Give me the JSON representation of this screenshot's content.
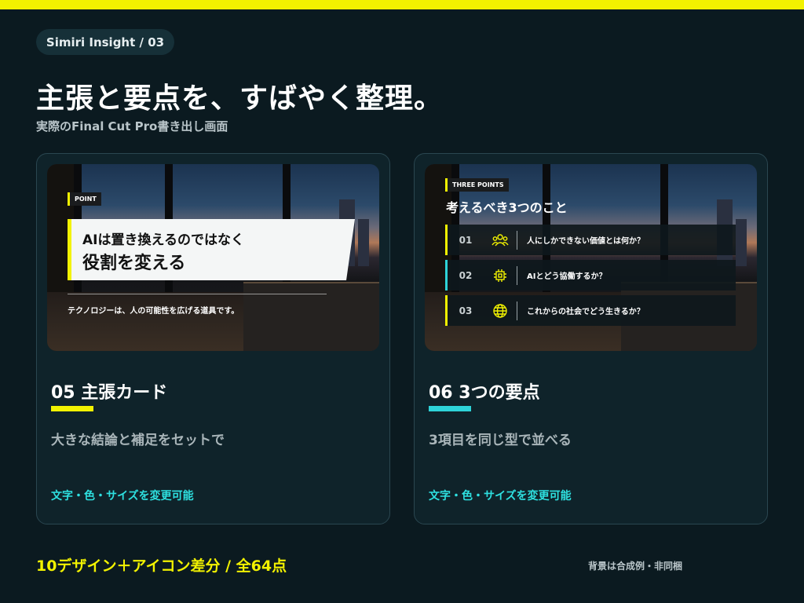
{
  "header": {
    "badge": "Simiri Insight / 03",
    "title": "主張と要点を、すばやく整理。",
    "subtitle": "実際のFinal Cut Pro書き出し画面"
  },
  "colors": {
    "background": "#0b1a20",
    "accent_yellow": "#f2f200",
    "accent_cyan": "#2ed3d8",
    "card_border": "#2a4650"
  },
  "cards": [
    {
      "preview": {
        "tag": "POINT",
        "line1": "AIは置き換えるのではなく",
        "line2": "役割を変える",
        "note": "テクノロジーは、人の可能性を広げる道具です。"
      },
      "title": "05 主張カード",
      "underline_color": "#f2f200",
      "description": "大きな結論と補足をセットで",
      "link": "文字・色・サイズを変更可能"
    },
    {
      "preview": {
        "tag": "THREE POINTS",
        "heading": "考えるべき3つのこと",
        "points": [
          {
            "num": "01",
            "icon": "people-icon",
            "text": "人にしかできない価値とは何か？",
            "bar_color": "#f2f200"
          },
          {
            "num": "02",
            "icon": "chip-icon",
            "text": "AIとどう協働するか？",
            "bar_color": "#2ed3d8"
          },
          {
            "num": "03",
            "icon": "globe-icon",
            "text": "これからの社会でどう生きるか？",
            "bar_color": "#f2f200"
          }
        ]
      },
      "title": "06 3つの要点",
      "underline_color": "#2ed3d8",
      "description": "3項目を同じ型で並べる",
      "link": "文字・色・サイズを変更可能"
    }
  ],
  "footer": {
    "left": "10デザイン＋アイコン差分 / 全64点",
    "right": "背景は合成例・非同梱"
  }
}
